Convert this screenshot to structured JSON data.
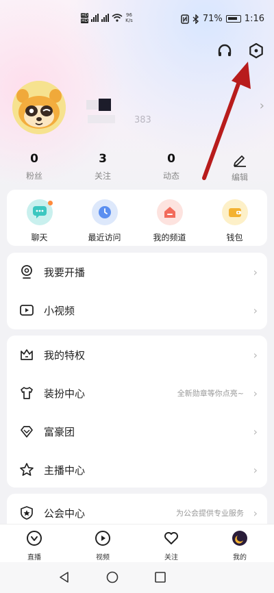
{
  "status_bar": {
    "sim1": "HD",
    "sim2": "HD",
    "net_speed": "96",
    "net_unit": "K/s",
    "battery": "71%",
    "time": "1:16"
  },
  "profile": {
    "uid_suffix": "383"
  },
  "stats": [
    {
      "value": "0",
      "label": "粉丝"
    },
    {
      "value": "3",
      "label": "关注"
    },
    {
      "value": "0",
      "label": "动态"
    },
    {
      "label": "编辑"
    }
  ],
  "quick_actions": [
    {
      "label": "聊天",
      "color": "#c9f0ee"
    },
    {
      "label": "最近访问",
      "color": "#dde8fb"
    },
    {
      "label": "我的频道",
      "color": "#fde3df"
    },
    {
      "label": "钱包",
      "color": "#fdf0c8"
    }
  ],
  "menu_group1": [
    {
      "label": "我要开播",
      "icon": "live-camera-icon"
    },
    {
      "label": "小视频",
      "icon": "video-play-icon"
    }
  ],
  "menu_group2": [
    {
      "label": "我的特权",
      "icon": "crown-icon"
    },
    {
      "label": "装扮中心",
      "icon": "shirt-icon",
      "hint": "全新勋章等你点亮~"
    },
    {
      "label": "富豪团",
      "icon": "diamond-icon"
    },
    {
      "label": "主播中心",
      "icon": "star-icon"
    }
  ],
  "menu_group3": [
    {
      "label": "公会中心",
      "icon": "shield-icon",
      "hint": "为公会提供专业服务"
    }
  ],
  "tabs": [
    {
      "label": "直播",
      "icon": "live-icon"
    },
    {
      "label": "视频",
      "icon": "video-icon"
    },
    {
      "label": "关注",
      "icon": "heart-icon"
    },
    {
      "label": "我的",
      "icon": "me-icon"
    }
  ],
  "colors": {
    "annotation_arrow": "#b81c1c",
    "accent": "#ff8a3c"
  }
}
